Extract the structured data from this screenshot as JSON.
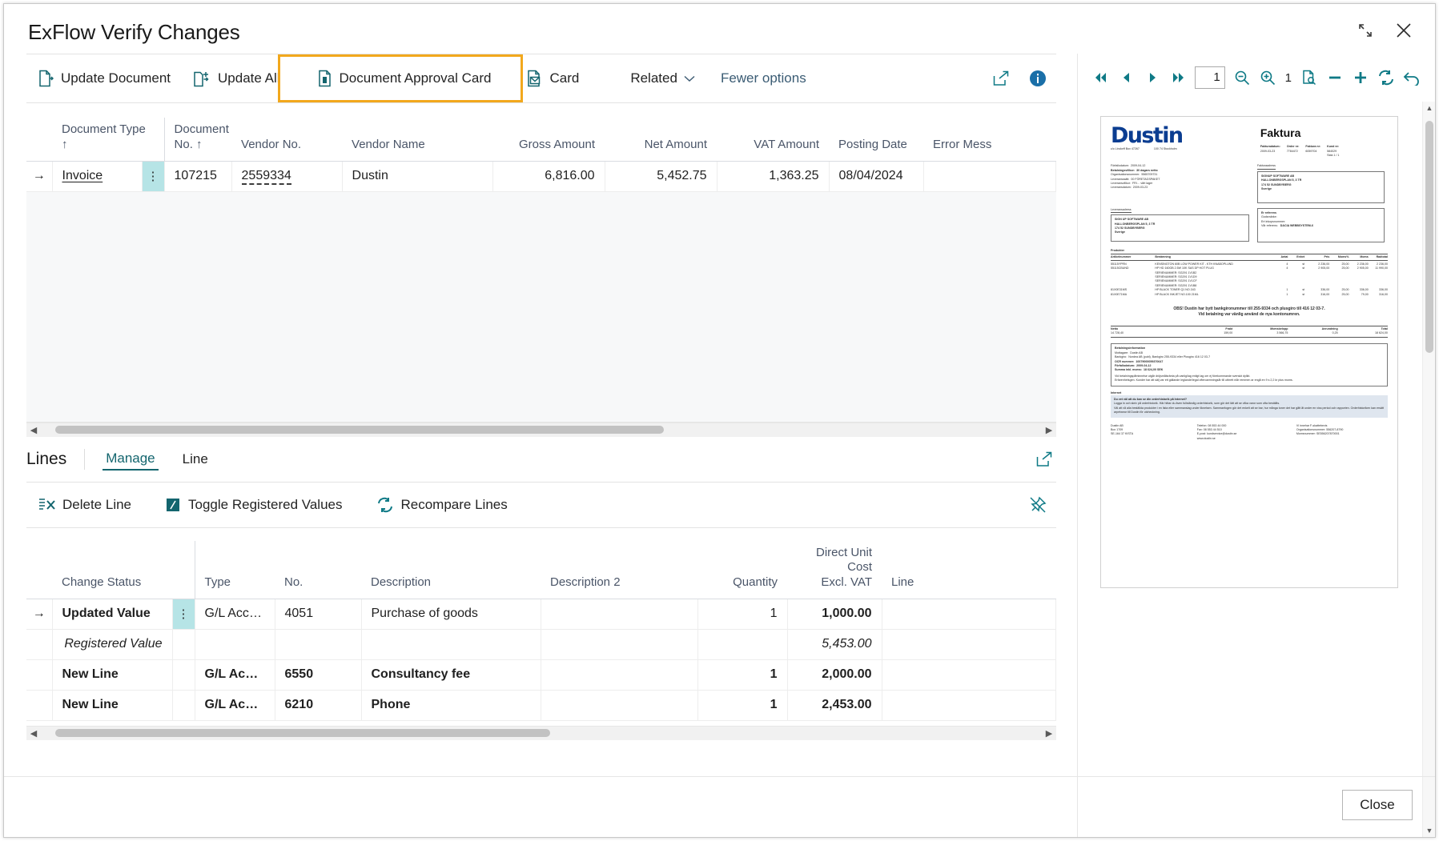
{
  "window": {
    "title": "ExFlow Verify Changes",
    "minimize_label": "Restore down",
    "close_label": "Close window"
  },
  "ribbon": {
    "buttons": [
      {
        "label": "Update Document",
        "icon": "update-document-icon"
      },
      {
        "label": "Update All",
        "icon": "update-all-icon"
      },
      {
        "label": "Document Approval Card",
        "icon": "document-approval-card-icon"
      },
      {
        "label": "Card",
        "icon": "card-icon"
      }
    ],
    "related_label": "Related",
    "fewer_options_label": "Fewer options",
    "share_icon": "share-icon",
    "info_icon": "info-icon",
    "highlight_color": "#f2a81d"
  },
  "documents_grid": {
    "columns": [
      {
        "label": "Document Type ↑",
        "align": "left"
      },
      {
        "label": "Document No. ↑",
        "align": "left"
      },
      {
        "label": "Vendor No.",
        "align": "left"
      },
      {
        "label": "Vendor Name",
        "align": "left"
      },
      {
        "label": "Gross Amount",
        "align": "right"
      },
      {
        "label": "Net Amount",
        "align": "right"
      },
      {
        "label": "VAT Amount",
        "align": "right"
      },
      {
        "label": "Posting Date",
        "align": "left"
      },
      {
        "label": "Error Mess",
        "align": "left"
      }
    ],
    "rows": [
      {
        "selected": true,
        "document_type": "Invoice",
        "document_no": "107215",
        "vendor_no": "2559334",
        "vendor_name": "Dustin",
        "gross_amount": "6,816.00",
        "net_amount": "5,452.75",
        "vat_amount": "1,363.25",
        "posting_date": "08/04/2024",
        "error_message": ""
      }
    ]
  },
  "lines_section": {
    "title": "Lines",
    "tabs": [
      {
        "label": "Manage",
        "active": true
      },
      {
        "label": "Line",
        "active": false
      }
    ],
    "share_icon": "share-icon",
    "actions": [
      {
        "label": "Delete Line",
        "icon": "delete-line-icon"
      },
      {
        "label": "Toggle Registered Values",
        "icon": "toggle-registered-values-icon"
      },
      {
        "label": "Recompare Lines",
        "icon": "recompare-lines-icon"
      }
    ],
    "pin_icon": "unpin-icon",
    "columns": [
      {
        "label": "Change Status",
        "align": "left"
      },
      {
        "label": "Type",
        "align": "left"
      },
      {
        "label": "No.",
        "align": "left"
      },
      {
        "label": "Description",
        "align": "left"
      },
      {
        "label": "Description 2",
        "align": "left"
      },
      {
        "label": "Quantity",
        "align": "right"
      },
      {
        "label": "Direct Unit Cost Excl. VAT",
        "align": "right"
      },
      {
        "label": "Line",
        "align": "left"
      }
    ],
    "direct_unit_cost_line1": "Direct Unit Cost",
    "direct_unit_cost_line2": "Excl. VAT",
    "rows": [
      {
        "style": "selected",
        "change_status": "Updated Value",
        "type": "G/L Account",
        "no": "4051",
        "description": "Purchase of goods",
        "description2": "",
        "quantity": "1",
        "direct_unit_cost": "1,000.00",
        "line": ""
      },
      {
        "style": "registered",
        "change_status": "Registered Value",
        "type": "",
        "no": "",
        "description": "",
        "description2": "",
        "quantity": "",
        "direct_unit_cost": "5,453.00",
        "line": ""
      },
      {
        "style": "new",
        "change_status": "New Line",
        "type": "G/L Accou…",
        "no": "6550",
        "description": "Consultancy fee",
        "description2": "",
        "quantity": "1",
        "direct_unit_cost": "2,000.00",
        "line": ""
      },
      {
        "style": "new",
        "change_status": "New Line",
        "type": "G/L Accou…",
        "no": "6210",
        "description": "Phone",
        "description2": "",
        "quantity": "1",
        "direct_unit_cost": "2,453.00",
        "line": ""
      }
    ]
  },
  "pdf_viewer": {
    "toolbar": [
      {
        "name": "first-page-button",
        "icon": "first-page-icon"
      },
      {
        "name": "previous-page-button",
        "icon": "previous-page-icon"
      },
      {
        "name": "next-page-button",
        "icon": "next-page-icon"
      },
      {
        "name": "last-page-button",
        "icon": "last-page-icon"
      }
    ],
    "page_number": "1",
    "page_of_label": "1",
    "zoom_out_icon": "zoom-out-icon",
    "zoom_in_icon": "zoom-in-icon",
    "fit_page_icon": "fit-page-icon",
    "minus_icon": "minus-icon",
    "plus_icon": "plus-icon",
    "rotate_icon": "rotate-icon",
    "undo_icon": "undo-icon",
    "document": {
      "logo_text": "Dustin",
      "logo_sub_left": "c/o Lindorff Box 47267",
      "logo_sub_right": "100 74 Stockholm",
      "title": "Faktura",
      "meta": [
        {
          "label": "Fakturadatum:",
          "value": "2009-03-23"
        },
        {
          "label": "Order nr:",
          "value": "7784472"
        },
        {
          "label": "Faktura nr:",
          "value": "6059704"
        },
        {
          "label": "Kund nr:",
          "value": "584029"
        }
      ],
      "page_note": "Sida 1 / 1",
      "left_fields": [
        {
          "label": "Förfallodatum:",
          "value": "2009-04-12",
          "bold": false
        },
        {
          "label": "Betalningsvillkor:",
          "value": "30 dagars netto",
          "bold": true
        },
        {
          "label": "Organisationsnummer:",
          "value": "5565709731",
          "bold": false
        },
        {
          "label": "Leveransssätt:",
          "value": "00 FÖRETAGSPAKET",
          "bold": false
        },
        {
          "label": "Leveransvillkor:",
          "value": "FRI… vårt lager",
          "bold": false
        },
        {
          "label": "Leveransdatum:",
          "value": "2009-03-23",
          "bold": false
        }
      ],
      "address_header": "Fakturaadress",
      "address_lines": [
        "SIGNUP SOFTWARE AB",
        "HALLONBERGSPLAN 5, 3 TR",
        "174 52 SUNDBYBERG",
        "Sverige"
      ],
      "delivery_header": "Leveransadress",
      "delivery_lines": [
        "SIGN UP SOFTWARE AB",
        "HALLONBERGSPLAN 5, 3 TR",
        "174 52 SUNDBYBERG",
        "Sverige"
      ],
      "ref_header": "Er referens",
      "ref_fields": [
        {
          "label": "Godsmärke:",
          "value": ""
        },
        {
          "label": "Ert inkopsnummer:",
          "value": ""
        },
        {
          "label": "Vår referens:",
          "value": "DACIA WEBBSYSTEM-6"
        }
      ],
      "products_header": "Produkter",
      "products_columns": [
        "Artikelnummer",
        "Benämning",
        "Antal",
        "Enhet",
        "Pris",
        "Moms%",
        "Moms",
        "Radtotal"
      ],
      "products_rows": [
        [
          "55115YPRN",
          "KENSINGTON 60B LOW POWER KIT - KTH KNABOPLUND",
          "4",
          "st",
          "2 236,00",
          "25,00",
          "2 236,00",
          "2 236,00"
        ],
        [
          "55115CBUND",
          "HP HD 160GB 2.5W 10K SAS DP HOT PLUG",
          "4",
          "st",
          "2 905,00",
          "25,00",
          "2 905,00",
          "11 990,00"
        ],
        [
          "",
          "SERIENUMMER:    SG291 1V1B2",
          "",
          "",
          "",
          "",
          "",
          ""
        ],
        [
          "",
          "SERIENUMMER:    SG291 1V1D9",
          "",
          "",
          "",
          "",
          "",
          ""
        ],
        [
          "",
          "SERIENUMMER:    SG291 1V1CF",
          "",
          "",
          "",
          "",
          "",
          ""
        ],
        [
          "",
          "SERIENUMMER:    SG291 1V1B8",
          "",
          "",
          "",
          "",
          "",
          ""
        ],
        [
          "81X0E31MS",
          "HP BLACK TONER Q1 NO.343",
          "1",
          "st",
          "336,00",
          "25,00",
          "336,00",
          "336,00"
        ],
        [
          "81X0E71MA",
          "HP BLACK INKJET NO.100 21ML",
          "1",
          "st",
          "316,00",
          "25,00",
          "79,00",
          "316,00"
        ]
      ],
      "notice": [
        "OBS! Dustin har bytt bankgironummer till 255-9334 och plusgiro till 416 12 03-7.",
        "Vid betalning var vänlig använd de nya kontonumren."
      ],
      "totals_columns": [
        "Netto",
        "Frakt",
        "Momsbelopp",
        "Avrundning",
        "Total"
      ],
      "totals_values": [
        "14 728,40",
        "159,00",
        "3 566,75",
        "0,25",
        "18 624,00"
      ],
      "payment_header": "Betalningsinformation",
      "payment_fields": [
        {
          "label": "Mottagare:",
          "value": "Dustin AB"
        },
        {
          "label": "Bankgiro:",
          "value": "Nordea AB (publ), Bankgiro 255-9334 eller Plusgiro 416 12 03-7"
        },
        {
          "label": "OCR nummer:",
          "value": "10079000059370647"
        },
        {
          "label": "Förfallodatum:",
          "value": "2009-04-12"
        },
        {
          "label": "Summa inkl. moms:",
          "value": "18 624,00 SEK"
        }
      ],
      "payment_note": [
        "Vid betalningspåminnelse utgår dröjsmålsränta på vanlig/lag enligt lag om ej förekommande svenskt dylikt.",
        "Erfarenhetsgen. Kunder har att sälj var ett gällande leglande/legal ofteroarmningsår till utbrett niår remmen ar engå en 9 s 2,2 kr plus moms."
      ],
      "internet_header": "Internet",
      "internet_note": [
        "Du vet väl att du kan se din orderhistorik på Internet?",
        "Logga in och skriv på orderhistorik. Här hittar du även fullständig orderhistorik, som gör det lätt att se vilka varor som ofta beställts.",
        "Väl att vå alla beställda produkter i en lista eller sammanslag under liknelsen. Sammanfogen gör det enkelt att se bar, hur många toner det har gått åt under en viss period och rapporten. Orderhistoriken kan ersätt arpetwear till Dustin för utcheckning."
      ],
      "footer_left": [
        "Dustin AB",
        "Box 1709",
        "SE-164 37 KISTA"
      ],
      "footer_mid": [
        "Telefon: 08 553 44 000",
        "Fax: 08 553 44 510",
        "E-post: kundservice@dustin.se",
        "www.dustin.se"
      ],
      "footer_right": [
        "Vi innehar F-skattebevis",
        "Organisationsnummer: 556207-8790",
        "Momsnummer: SE556207870001"
      ]
    }
  },
  "footer": {
    "close_label": "Close"
  }
}
